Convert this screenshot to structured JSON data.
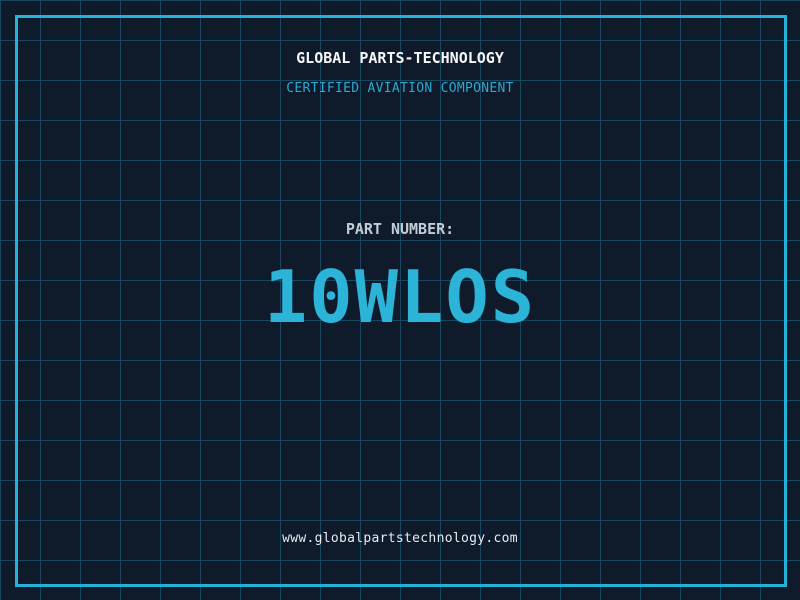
{
  "header": {
    "title": "GLOBAL PARTS-TECHNOLOGY",
    "subtitle": "CERTIFIED AVIATION COMPONENT"
  },
  "part": {
    "label": "PART NUMBER:",
    "number": "10WLOS"
  },
  "footer": {
    "url": "www.globalpartstechnology.com"
  },
  "colors": {
    "background": "#0f1a2b",
    "grid_line": "#17485f",
    "frame_border": "#25b2d9",
    "title_text": "#f5f7f8",
    "subtitle_text": "#2ba9cf",
    "part_label_text": "#c3cdd8",
    "part_number_text": "#2bb3d8",
    "url_text": "#e6ecf0"
  }
}
